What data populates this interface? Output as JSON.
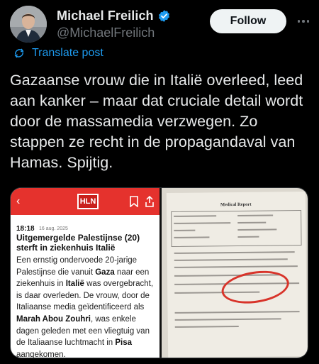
{
  "author": {
    "display_name": "Michael Freilich",
    "handle": "@MichaelFreilich",
    "verified": true
  },
  "actions": {
    "follow_label": "Follow",
    "more_icon": "more-horizontal-icon"
  },
  "translate": {
    "label": "Translate post",
    "icon": "translate-icon"
  },
  "post": {
    "text": "Gazaanse vrouw die in Italië overleed, leed aan kanker – maar dat cruciale detail wordt door de massamedia verzwegen. Zo stappen ze recht in de propagandaval van Hamas. Spijtig."
  },
  "media": {
    "article": {
      "logo": "HLN",
      "time": "18:18",
      "date": "16 aug. 2025",
      "headline": "Uitgemergelde Palestijnse (20) sterft in ziekenhuis Italië",
      "body": [
        {
          "t": "Een ernstig ondervoede 20-jarige Palestijnse die vanuit ",
          "b": false
        },
        {
          "t": "Gaza",
          "b": true
        },
        {
          "t": " naar een ziekenhuis in ",
          "b": false
        },
        {
          "t": "Italië",
          "b": true
        },
        {
          "t": " was overgebracht, is daar overleden. De vrouw, door de Italiaanse media geïdentificeerd als ",
          "b": false
        },
        {
          "t": "Marah Abou Zouhri",
          "b": true
        },
        {
          "t": ", was enkele dagen geleden met een vliegtuig van de Italiaanse luchtmacht in ",
          "b": false
        },
        {
          "t": "Pisa",
          "b": true
        },
        {
          "t": " aangekomen.",
          "b": false
        }
      ]
    },
    "document": {
      "title": "Medical Report"
    }
  },
  "colors": {
    "background": "#000000",
    "accent": "#1d9bf0",
    "verified": "#1d9bf0",
    "hln_red": "#e5322d",
    "annotation_red": "#d8342a"
  }
}
